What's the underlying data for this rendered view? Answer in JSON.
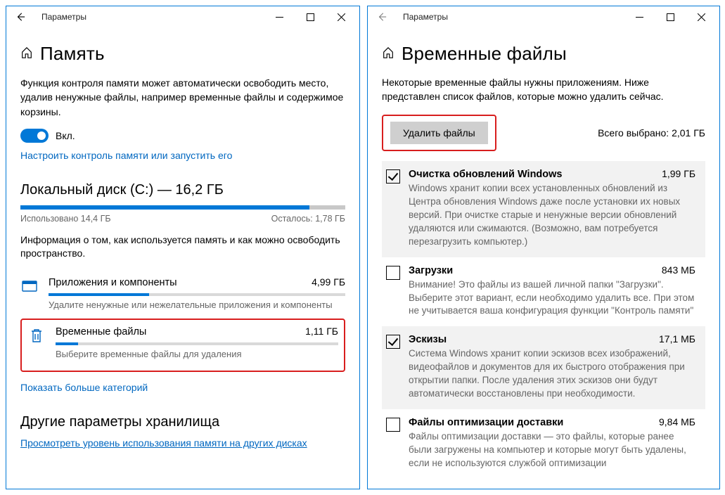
{
  "left": {
    "titlebar": "Параметры",
    "heading": "Память",
    "desc": "Функция контроля памяти может автоматически освободить место, удалив ненужные файлы, например временные файлы и содержимое корзины.",
    "toggle_label": "Вкл.",
    "config_link": "Настроить контроль памяти или запустить его",
    "disk_heading": "Локальный диск (C:) — 16,2 ГБ",
    "disk_used_pct": 89,
    "disk_used": "Использовано 14,4 ГБ",
    "disk_free": "Осталось: 1,78 ГБ",
    "info": "Информация о том, как используется память и как можно освободить пространство.",
    "cat_apps": {
      "title": "Приложения и компоненты",
      "size": "4,99 ГБ",
      "pct": 34,
      "sub": "Удалите ненужные или нежелательные приложения и компоненты"
    },
    "cat_temp": {
      "title": "Временные файлы",
      "size": "1,11 ГБ",
      "pct": 8,
      "sub": "Выберите временные файлы для удаления"
    },
    "showmore": "Показать больше категорий",
    "other_heading": "Другие параметры хранилища",
    "other_link": "Просмотреть уровень использования памяти на других дисках"
  },
  "right": {
    "titlebar": "Параметры",
    "heading": "Временные файлы",
    "desc": "Некоторые временные файлы нужны приложениям. Ниже представлен список файлов, которые можно удалить сейчас.",
    "delete_btn": "Удалить файлы",
    "total": "Всего выбрано: 2,01 ГБ",
    "items": [
      {
        "title": "Очистка обновлений Windows",
        "size": "1,99 ГБ",
        "checked": true,
        "desc": "Windows хранит копии всех установленных обновлений из Центра обновления Windows даже после установки их новых версий. При очистке старые и ненужные версии обновлений удаляются или сжимаются. (Возможно, вам потребуется перезагрузить компьютер.)"
      },
      {
        "title": "Загрузки",
        "size": "843 МБ",
        "checked": false,
        "desc": "Внимание! Это файлы из вашей личной папки \"Загрузки\". Выберите этот вариант, если необходимо удалить все. При этом не учитывается ваша конфигурация функции \"Контроль памяти\""
      },
      {
        "title": "Эскизы",
        "size": "17,1 МБ",
        "checked": true,
        "desc": "Система Windows хранит копии эскизов всех изображений, видеофайлов и документов для их быстрого отображения при открытии папки. После удаления этих эскизов они будут автоматически восстановлены при необходимости."
      },
      {
        "title": "Файлы оптимизации доставки",
        "size": "9,84 МБ",
        "checked": false,
        "desc": "Файлы оптимизации доставки — это файлы, которые ранее были загружены на компьютер и которые могут быть удалены, если не используются службой оптимизации"
      }
    ]
  }
}
